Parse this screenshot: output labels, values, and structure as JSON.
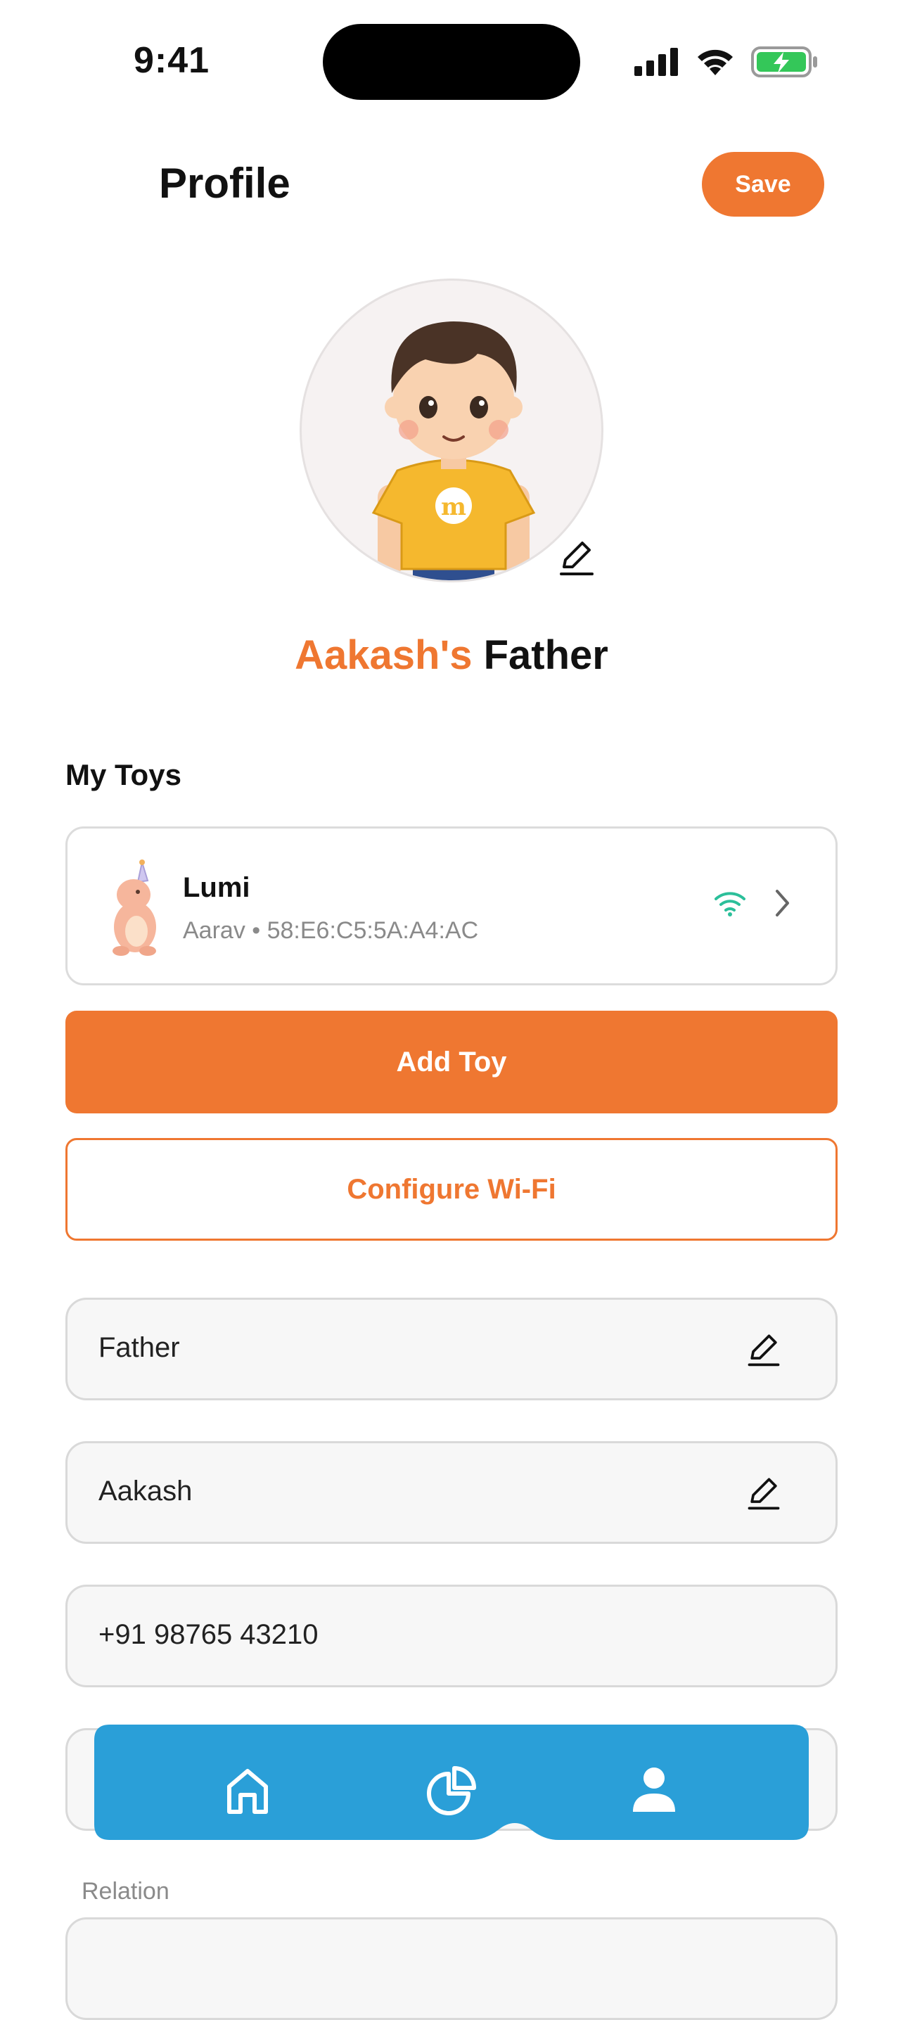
{
  "status_bar": {
    "time": "9:41"
  },
  "header": {
    "title": "Profile",
    "save_label": "Save"
  },
  "profile": {
    "child_name": "Aakash's",
    "relation_title": "Father"
  },
  "my_toys": {
    "section_title": "My Toys",
    "toys": [
      {
        "name": "Lumi",
        "subtitle": "Aarav • 58:E6:C5:5A:A4:AC",
        "wifi_connected": true
      }
    ]
  },
  "actions": {
    "add_toy_label": "Add Toy",
    "configure_wifi_label": "Configure Wi-Fi"
  },
  "fields": {
    "relation_value": "Father",
    "child_name_value": "Aakash",
    "phone_value": "+91 98765 43210",
    "relation_label": "Relation"
  },
  "bottom_nav": {
    "items": [
      "home-icon",
      "chart-icon",
      "profile-icon"
    ],
    "active": "profile-icon"
  },
  "colors": {
    "accent": "#ef7731",
    "nav_bg": "#2a9fd8",
    "wifi": "#2bbf9a",
    "battery": "#34c759"
  }
}
